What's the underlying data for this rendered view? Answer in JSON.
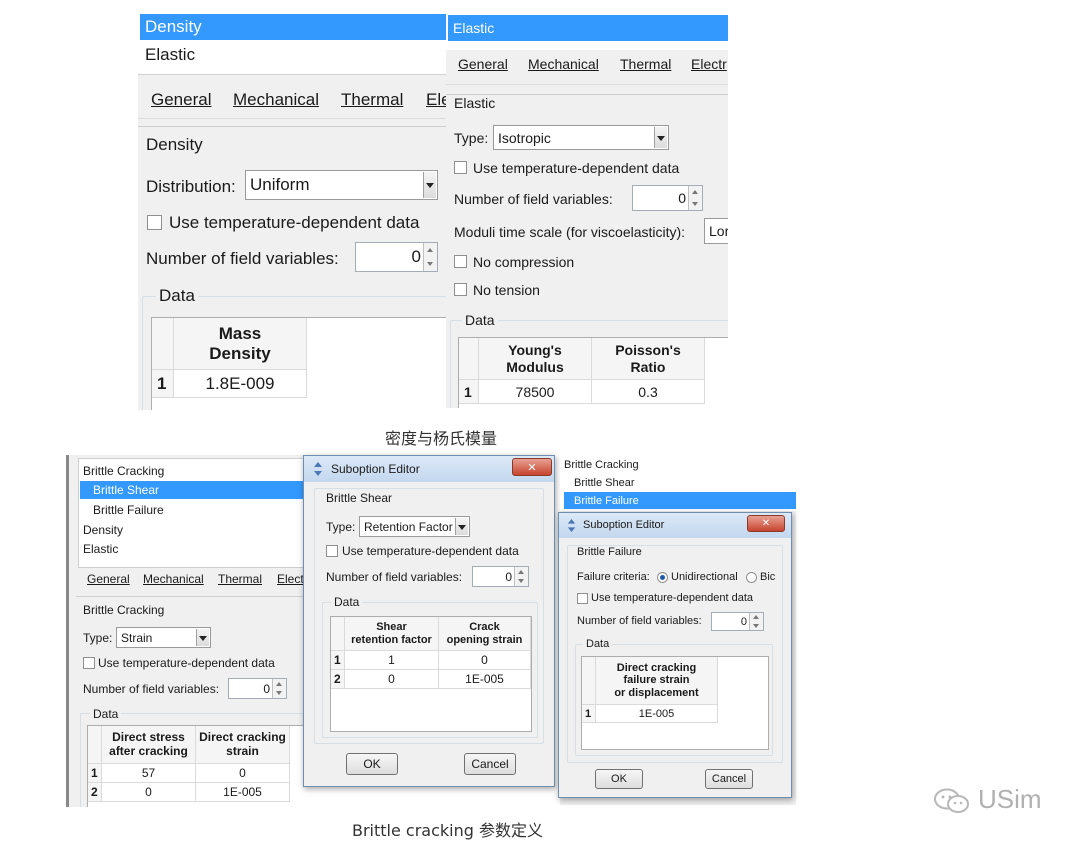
{
  "density_panel": {
    "tree": [
      "Density",
      "Elastic"
    ],
    "menu": [
      "General",
      "Mechanical",
      "Thermal",
      "Ele"
    ],
    "section": "Density",
    "distribution_label": "Distribution:",
    "distribution_value": "Uniform",
    "temp_dep_label": "Use temperature-dependent data",
    "field_vars_label": "Number of field variables:",
    "field_vars_value": "0",
    "data_label": "Data",
    "table": {
      "headers": [
        "Mass\nDensity"
      ],
      "rows": [
        [
          "1",
          "1.8E-009"
        ]
      ]
    }
  },
  "elastic_panel": {
    "tree_selected": "Elastic",
    "menu": [
      "General",
      "Mechanical",
      "Thermal",
      "Electr"
    ],
    "section": "Elastic",
    "type_label": "Type:",
    "type_value": "Isotropic",
    "temp_dep_label": "Use temperature-dependent data",
    "field_vars_label": "Number of field variables:",
    "field_vars_value": "0",
    "moduli_label": "Moduli time scale (for viscoelasticity):",
    "moduli_value": "Lor",
    "no_compression": "No compression",
    "no_tension": "No tension",
    "data_label": "Data",
    "table": {
      "headers": [
        "Young's\nModulus",
        "Poisson's\nRatio"
      ],
      "rows": [
        [
          "1",
          "78500",
          "0.3"
        ]
      ]
    }
  },
  "caption_top": "密度与杨氏模量",
  "brittle_left": {
    "tree": [
      "Brittle Cracking",
      "Brittle Shear",
      "Brittle Failure",
      "Density",
      "Elastic"
    ],
    "menu": [
      "General",
      "Mechanical",
      "Thermal",
      "Elect"
    ],
    "section": "Brittle Cracking",
    "type_label": "Type:",
    "type_value": "Strain",
    "temp_dep_label": "Use temperature-dependent data",
    "field_vars_label": "Number of field variables:",
    "field_vars_value": "0",
    "data_label": "Data",
    "table": {
      "headers": [
        "Direct stress\nafter cracking",
        "Direct cracking\nstrain"
      ],
      "rows": [
        [
          "1",
          "57",
          "0"
        ],
        [
          "2",
          "0",
          "1E-005"
        ]
      ]
    }
  },
  "shear_dialog": {
    "title": "Suboption Editor",
    "section": "Brittle Shear",
    "type_label": "Type:",
    "type_value": "Retention Factor",
    "temp_dep_label": "Use temperature-dependent data",
    "field_vars_label": "Number of field variables:",
    "field_vars_value": "0",
    "data_label": "Data",
    "table": {
      "headers": [
        "Shear\nretention factor",
        "Crack\nopening strain"
      ],
      "rows": [
        [
          "1",
          "1",
          "0"
        ],
        [
          "2",
          "0",
          "1E-005"
        ]
      ]
    },
    "ok": "OK",
    "cancel": "Cancel"
  },
  "brittle_right": {
    "tree": [
      "Brittle Cracking",
      "Brittle Shear",
      "Brittle Failure"
    ]
  },
  "failure_dialog": {
    "title": "Suboption Editor",
    "section": "Brittle Failure",
    "criteria_label": "Failure criteria:",
    "criteria_option1": "Unidirectional",
    "criteria_option2": "Bic",
    "temp_dep_label": "Use temperature-dependent data",
    "field_vars_label": "Number of field variables:",
    "field_vars_value": "0",
    "data_label": "Data",
    "table": {
      "headers": [
        "Direct cracking\nfailure strain\nor displacement"
      ],
      "rows": [
        [
          "1",
          "1E-005"
        ]
      ]
    },
    "ok": "OK",
    "cancel": "Cancel"
  },
  "caption_bottom": "Brittle cracking 参数定义",
  "watermark": "USim"
}
